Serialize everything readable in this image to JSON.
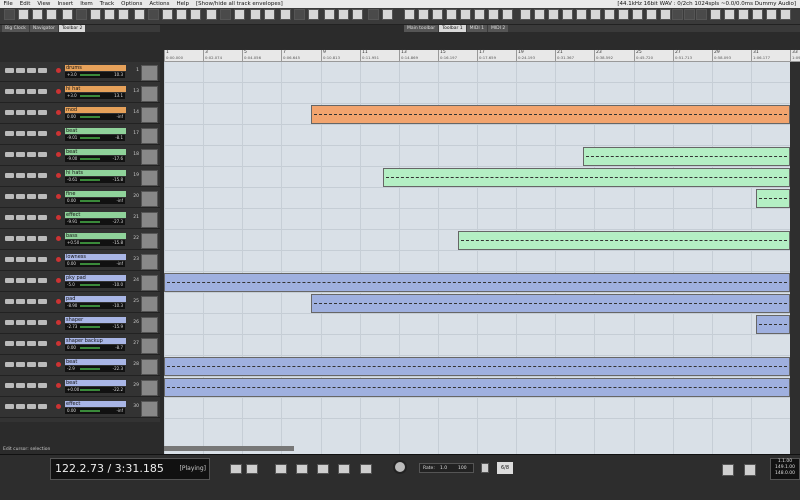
{
  "menu": [
    "File",
    "Edit",
    "View",
    "Insert",
    "Item",
    "Track",
    "Options",
    "Actions",
    "Help",
    "[Show/hide all track envelopes]"
  ],
  "status": "[44.1kHz 16bit WAV : 0/2ch 1024spls ~0.0/0.0ms Dummy Audio]",
  "dock_left_tabs": [
    "Big Clock",
    "Navigator",
    "Toolbar 2"
  ],
  "dock_right_tabs": [
    "Main toolbar",
    "Toolbar 1",
    "MIDI 1",
    "MIDI 2"
  ],
  "ruler": [
    {
      "bar": "1",
      "time": "0:00.000"
    },
    {
      "bar": "3",
      "time": "0:02.074"
    },
    {
      "bar": "5",
      "time": "0:04.056"
    },
    {
      "bar": "7",
      "time": "0:06.645"
    },
    {
      "bar": "9",
      "time": "0:10.813"
    },
    {
      "bar": "11",
      "time": "0:11.951"
    },
    {
      "bar": "13",
      "time": "0:14.869"
    },
    {
      "bar": "15",
      "time": "0:16.197"
    },
    {
      "bar": "17",
      "time": "0:17.659"
    },
    {
      "bar": "19",
      "time": "0:24.193"
    },
    {
      "bar": "21",
      "time": "0:31.367"
    },
    {
      "bar": "23",
      "time": "0:38.592"
    },
    {
      "bar": "25",
      "time": "0:45.720"
    },
    {
      "bar": "27",
      "time": "0:51.713"
    },
    {
      "bar": "29",
      "time": "0:58.093"
    },
    {
      "bar": "31",
      "time": "1:06.177"
    },
    {
      "bar": "33",
      "time": "1:09.657"
    }
  ],
  "tracks": [
    {
      "name": "drums",
      "vol": "+3.0",
      "pan": "10.3",
      "num": "1",
      "color": "#e6a15a"
    },
    {
      "name": "hi hat",
      "vol": "+3.0",
      "pan": "13.1",
      "num": "13",
      "color": "#e6a15a"
    },
    {
      "name": "mod",
      "vol": "0.00",
      "pan": "-inf",
      "num": "14",
      "color": "#e6a15a"
    },
    {
      "name": "beat",
      "vol": "-9.01",
      "pan": "-8.1",
      "num": "17",
      "color": "#8fd29a"
    },
    {
      "name": "beat",
      "vol": "-9.00",
      "pan": "-17.6",
      "num": "18",
      "color": "#8fd29a"
    },
    {
      "name": "hi hats",
      "vol": "-0.61",
      "pan": "-15.8",
      "num": "19",
      "color": "#8fd29a"
    },
    {
      "name": "fine",
      "vol": "0.00",
      "pan": "-inf",
      "num": "20",
      "color": "#8fd29a"
    },
    {
      "name": "effect",
      "vol": "-9.91",
      "pan": "-27.3",
      "num": "21",
      "color": "#8fd29a"
    },
    {
      "name": "bass",
      "vol": "+0.50",
      "pan": "-15.8",
      "num": "22",
      "color": "#8fd29a"
    },
    {
      "name": "lowness",
      "vol": "0.00",
      "pan": "-inf",
      "num": "23",
      "color": "#a9b6e6"
    },
    {
      "name": "pky pad",
      "vol": "-5.0",
      "pan": "-10.0",
      "num": "24",
      "color": "#a9b6e6"
    },
    {
      "name": "pad",
      "vol": "-8.90",
      "pan": "-10.3",
      "num": "25",
      "color": "#a9b6e6"
    },
    {
      "name": "shaper",
      "vol": "-2.73",
      "pan": "-15.9",
      "num": "26",
      "color": "#a9b6e6"
    },
    {
      "name": "shaper backup",
      "vol": "0.00",
      "pan": "-8.7",
      "num": "27",
      "color": "#a9b6e6"
    },
    {
      "name": "beat",
      "vol": "-2.9",
      "pan": "-22.3",
      "num": "28",
      "color": "#a9b6e6"
    },
    {
      "name": "beat",
      "vol": "+0.00",
      "pan": "-22.2",
      "num": "29",
      "color": "#a9b6e6"
    },
    {
      "name": "effect",
      "vol": "0.00",
      "pan": "-inf",
      "num": "30",
      "color": "#a9b6e6"
    }
  ],
  "items": [
    {
      "lane": 2,
      "from": 0.235,
      "to": 1.0,
      "color": "#f2a46e"
    },
    {
      "lane": 4,
      "from": 0.67,
      "to": 1.0,
      "color": "#b4efc4"
    },
    {
      "lane": 5,
      "from": 0.35,
      "to": 1.0,
      "color": "#b4efc4"
    },
    {
      "lane": 6,
      "from": 0.945,
      "to": 1.0,
      "color": "#b4efc4"
    },
    {
      "lane": 8,
      "from": 0.47,
      "to": 1.0,
      "color": "#b4efc4"
    },
    {
      "lane": 10,
      "from": 0.0,
      "to": 1.0,
      "color": "#9fb0df"
    },
    {
      "lane": 11,
      "from": 0.235,
      "to": 1.0,
      "color": "#9fb0df"
    },
    {
      "lane": 12,
      "from": 0.945,
      "to": 1.0,
      "color": "#9fb0df"
    },
    {
      "lane": 14,
      "from": 0.0,
      "to": 1.0,
      "color": "#9fb0df"
    },
    {
      "lane": 15,
      "from": 0.0,
      "to": 1.0,
      "color": "#9fb0df"
    }
  ],
  "hint": "Edit cursor: selection",
  "transport": {
    "position": "122.2.73 / 3:31.185",
    "state": "[Playing]",
    "rate_label": "Rate:",
    "rate_value": "1.0",
    "rate_max": "100",
    "timesig": "6/8",
    "bpm": "120",
    "right_box": [
      "1.1.00",
      "149.1.00",
      "148.0.00"
    ]
  }
}
